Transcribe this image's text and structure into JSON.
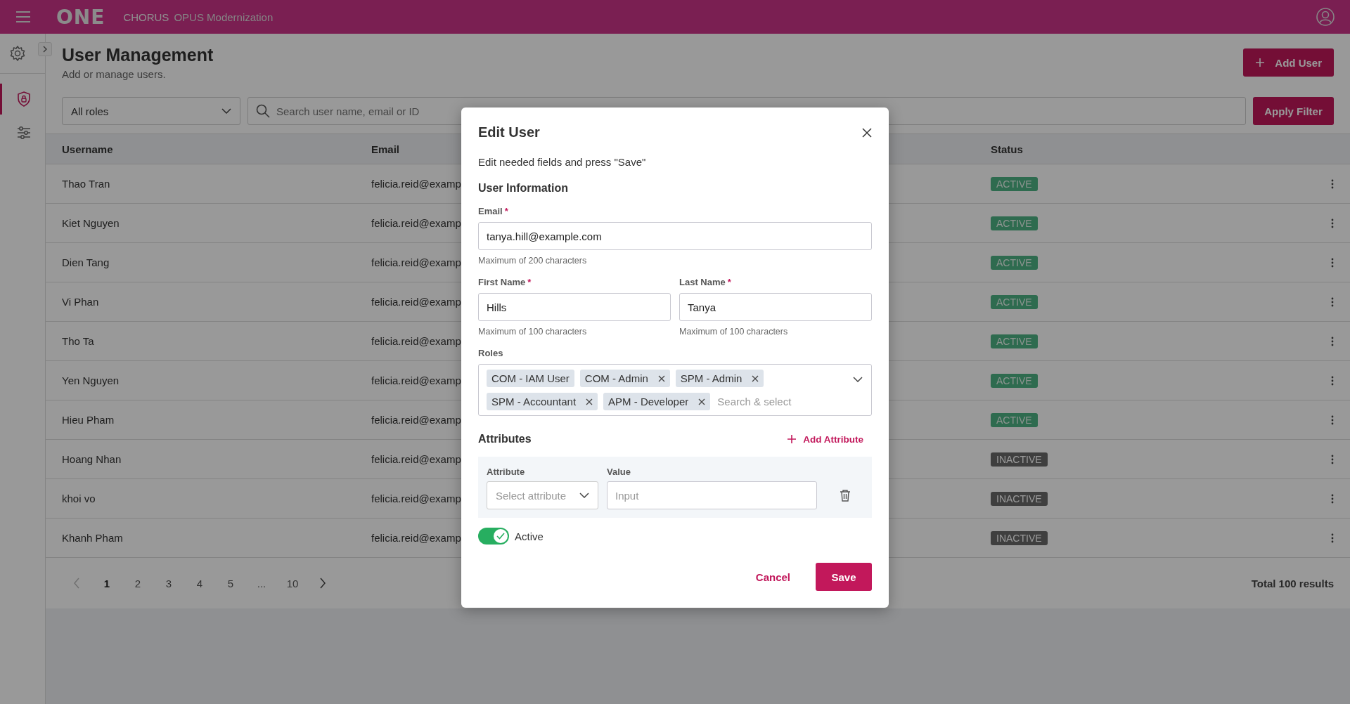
{
  "header": {
    "logo": "ONE",
    "app_name": "CHORUS",
    "app_subtitle": "OPUS Modernization"
  },
  "sidebar": {
    "items": [
      {
        "selected": true
      },
      {
        "selected": false
      }
    ]
  },
  "page": {
    "title": "User Management",
    "subtitle": "Add or manage users.",
    "add_button": "Add User"
  },
  "filters": {
    "role_select": "All roles",
    "search_placeholder": "Search user name, email or ID",
    "apply_button": "Apply Filter"
  },
  "table": {
    "columns": [
      "Username",
      "Email",
      "Status"
    ],
    "rows": [
      {
        "username": "Thao Tran",
        "email": "felicia.reid@examp",
        "status": {
          "label": "ACTIVE",
          "kind": "active"
        }
      },
      {
        "username": "Kiet Nguyen",
        "email": "felicia.reid@examp",
        "status": {
          "label": "ACTIVE",
          "kind": "active"
        }
      },
      {
        "username": "Dien Tang",
        "email": "felicia.reid@examp",
        "status": {
          "label": "ACTIVE",
          "kind": "active"
        }
      },
      {
        "username": "Vi Phan",
        "email": "felicia.reid@examp",
        "status": {
          "label": "ACTIVE",
          "kind": "active"
        }
      },
      {
        "username": "Tho Ta",
        "email": "felicia.reid@examp",
        "status": {
          "label": "ACTIVE",
          "kind": "active"
        }
      },
      {
        "username": "Yen Nguyen",
        "email": "felicia.reid@examp",
        "status": {
          "label": "ACTIVE",
          "kind": "active"
        }
      },
      {
        "username": "Hieu Pham",
        "email": "felicia.reid@examp",
        "status": {
          "label": "ACTIVE",
          "kind": "active"
        }
      },
      {
        "username": "Hoang Nhan",
        "email": "felicia.reid@examp",
        "status": {
          "label": "INACTIVE",
          "kind": "inactive"
        }
      },
      {
        "username": "khoi vo",
        "email": "felicia.reid@examp",
        "status": {
          "label": "INACTIVE",
          "kind": "inactive"
        }
      },
      {
        "username": "Khanh Pham",
        "email": "felicia.reid@examp",
        "status": {
          "label": "INACTIVE",
          "kind": "inactive"
        }
      }
    ]
  },
  "pagination": {
    "pages": [
      {
        "label": "1",
        "selected": true
      },
      {
        "label": "2",
        "selected": false
      },
      {
        "label": "3",
        "selected": false
      },
      {
        "label": "4",
        "selected": false
      },
      {
        "label": "5",
        "selected": false
      },
      {
        "label": "...",
        "selected": false
      },
      {
        "label": "10",
        "selected": false
      }
    ],
    "prev_disabled": true,
    "total": "Total 100 results"
  },
  "modal": {
    "title": "Edit User",
    "description": "Edit needed fields and press \"Save\"",
    "section": "User Information",
    "email": {
      "label": "Email",
      "required_mark": "*",
      "value": "tanya.hill@example.com",
      "hint": "Maximum of 200 characters"
    },
    "first_name": {
      "label": "First Name",
      "required_mark": "*",
      "value": "Hills",
      "hint": "Maximum of 100 characters"
    },
    "last_name": {
      "label": "Last Name",
      "required_mark": "*",
      "value": "Tanya",
      "hint": "Maximum of 100 characters"
    },
    "roles": {
      "label": "Roles",
      "tags": [
        {
          "label": "COM - IAM User",
          "removable": false
        },
        {
          "label": "COM - Admin",
          "removable": true
        },
        {
          "label": "SPM - Admin",
          "removable": true
        },
        {
          "label": "SPM - Accountant",
          "removable": true
        },
        {
          "label": "APM - Developer",
          "removable": true
        }
      ],
      "placeholder": "Search & select"
    },
    "attributes": {
      "title": "Attributes",
      "add_button": "Add Attribute",
      "rows": [
        {
          "attribute_label": "Attribute",
          "attribute_placeholder": "Select attribute",
          "value_label": "Value",
          "value_placeholder": "Input"
        }
      ]
    },
    "active": {
      "label": "Active",
      "on": true
    },
    "cancel_button": "Cancel",
    "save_button": "Save"
  }
}
